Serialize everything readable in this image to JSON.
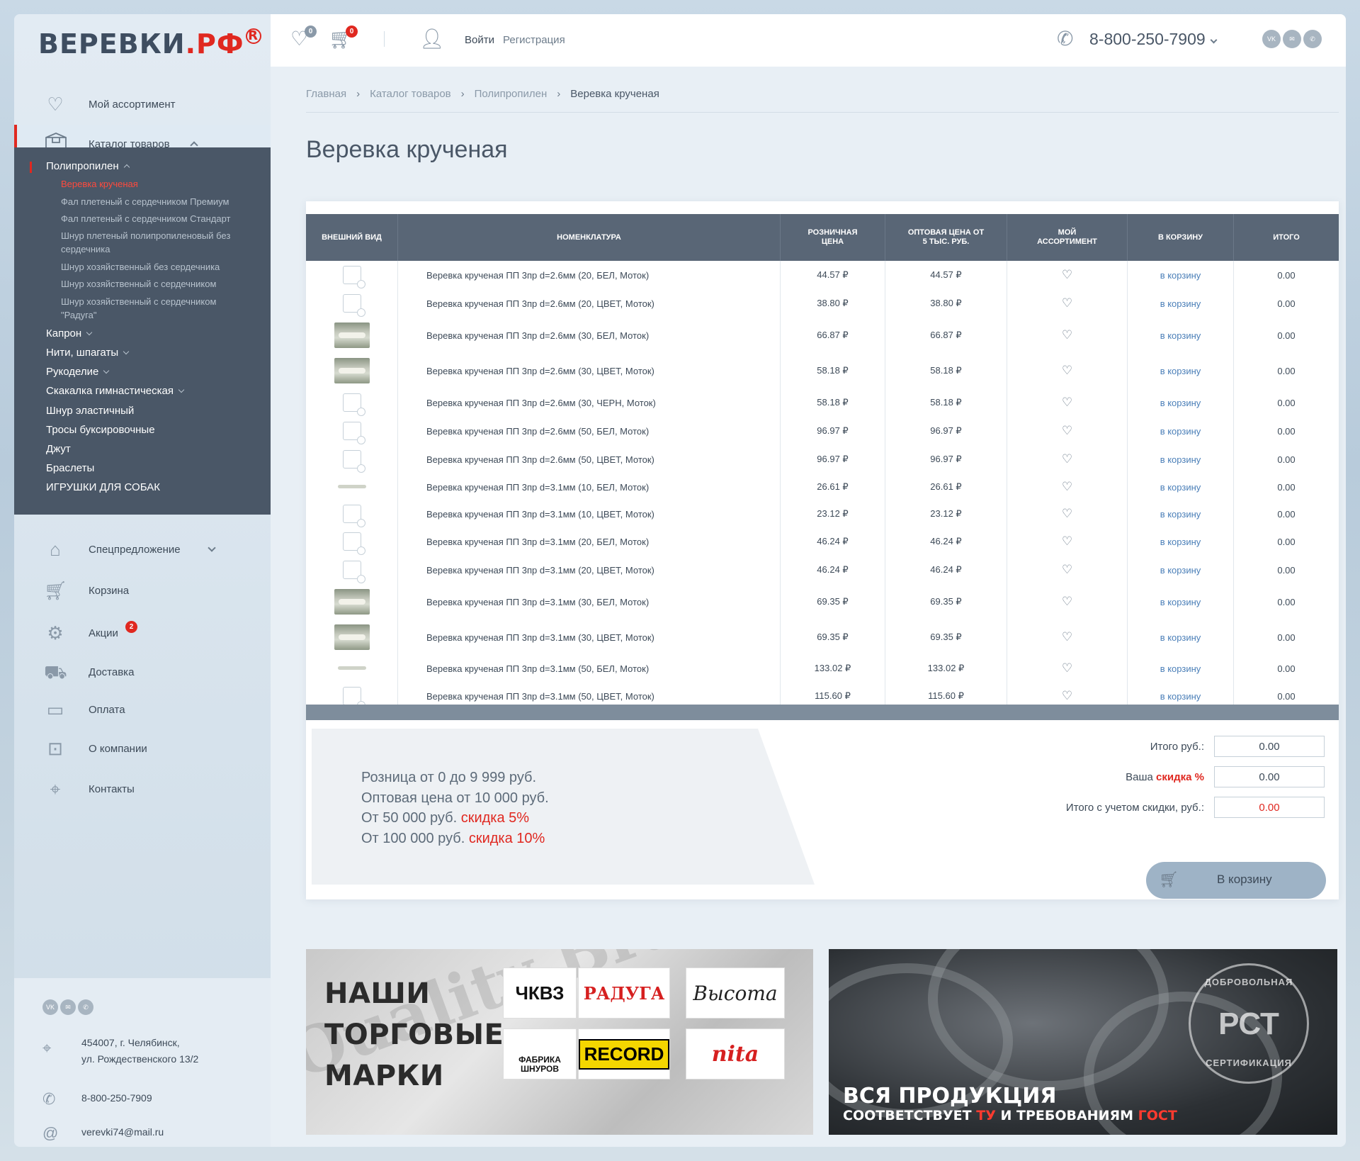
{
  "logo": {
    "text": "ВЕРЕВКИ",
    "suffix": ".РФ",
    "reg": "R"
  },
  "sidebar": {
    "items": [
      {
        "label": "Мой ассортимент",
        "icon": "heart-icon"
      },
      {
        "label": "Каталог товаров",
        "icon": "box-icon"
      },
      {
        "label": "Спецпредложение",
        "icon": "tag-icon"
      },
      {
        "label": "Корзина",
        "icon": "cart-icon"
      },
      {
        "label": "Акции",
        "icon": "percent-gear-icon",
        "badge": "2"
      },
      {
        "label": "Доставка",
        "icon": "truck-icon"
      },
      {
        "label": "Оплата",
        "icon": "card-icon"
      },
      {
        "label": "О компании",
        "icon": "briefcase-icon"
      },
      {
        "label": "Контакты",
        "icon": "location-icon"
      }
    ],
    "catalog": {
      "group": "Полипропилен",
      "subs": [
        "Веревка крученая",
        "Фал плетеный с сердечником Премиум",
        "Фал плетеный с сердечником Стандарт",
        "Шнур плетеный полипропиленовый без сердечника",
        "Шнур хозяйственный без сердечника",
        "Шнур хозяйственный с сердечником",
        "Шнур хозяйственный с сердечником \"Радуга\""
      ],
      "others": [
        "Капрон",
        "Нити, шпагаты",
        "Рукоделие",
        "Скакалка гимнастическая",
        "Шнур эластичный",
        "Тросы буксировочные",
        "Джут",
        "Браслеты",
        "ИГРУШКИ ДЛЯ СОБАК"
      ]
    },
    "contacts": {
      "social": [
        "VK",
        "✉",
        "✆"
      ],
      "address_1": "454007, г. Челябинск,",
      "address_2": "ул. Рождественского 13/2",
      "phone": "8-800-250-7909",
      "email": "verevki74@mail.ru"
    }
  },
  "header": {
    "favorites_count": "0",
    "cart_count": "0",
    "login": "Войти",
    "register": "Регистрация",
    "phone": "8-800-250-7909",
    "social": [
      "VK",
      "✉",
      "✆"
    ]
  },
  "breadcrumbs": [
    "Главная",
    "Каталог товаров",
    "Полипропилен",
    "Веревка крученая"
  ],
  "page_title": "Веревка крученая",
  "table": {
    "headers": [
      "ВНЕШНИЙ ВИД",
      "НОМЕНКЛАТУРА",
      "РОЗНИЧНАЯ ЦЕНА",
      "ОПТОВАЯ ЦЕНА ОТ 5 ТЫС. РУБ.",
      "МОЙ АССОРТИМЕНТ",
      "В КОРЗИНУ",
      "ИТОГО"
    ],
    "cart_label": "в корзину",
    "rows": [
      {
        "img": "none",
        "name": "Веревка крученая ПП 3пр d=2.6мм (20, БЕЛ, Моток)",
        "retail": "44.57 ₽",
        "wholesale": "44.57 ₽",
        "total": "0.00"
      },
      {
        "img": "none",
        "name": "Веревка крученая ПП 3пр d=2.6мм (20, ЦВЕТ, Моток)",
        "retail": "38.80 ₽",
        "wholesale": "38.80 ₽",
        "total": "0.00"
      },
      {
        "img": "photo",
        "name": "Веревка крученая ПП 3пр d=2.6мм (30, БЕЛ, Моток)",
        "retail": "66.87 ₽",
        "wholesale": "66.87 ₽",
        "total": "0.00"
      },
      {
        "img": "photo",
        "name": "Веревка крученая ПП 3пр d=2.6мм (30, ЦВЕТ, Моток)",
        "retail": "58.18 ₽",
        "wholesale": "58.18 ₽",
        "total": "0.00"
      },
      {
        "img": "none",
        "name": "Веревка крученая ПП 3пр d=2.6мм (30, ЧЕРН, Моток)",
        "retail": "58.18 ₽",
        "wholesale": "58.18 ₽",
        "total": "0.00"
      },
      {
        "img": "none",
        "name": "Веревка крученая ПП 3пр d=2.6мм (50, БЕЛ, Моток)",
        "retail": "96.97 ₽",
        "wholesale": "96.97 ₽",
        "total": "0.00"
      },
      {
        "img": "none",
        "name": "Веревка крученая ПП 3пр d=2.6мм (50, ЦВЕТ, Моток)",
        "retail": "96.97 ₽",
        "wholesale": "96.97 ₽",
        "total": "0.00"
      },
      {
        "img": "small",
        "name": "Веревка крученая ПП 3пр d=3.1мм (10, БЕЛ, Моток)",
        "retail": "26.61 ₽",
        "wholesale": "26.61 ₽",
        "total": "0.00"
      },
      {
        "img": "none",
        "name": "Веревка крученая ПП 3пр d=3.1мм (10, ЦВЕТ, Моток)",
        "retail": "23.12 ₽",
        "wholesale": "23.12 ₽",
        "total": "0.00"
      },
      {
        "img": "none",
        "name": "Веревка крученая ПП 3пр d=3.1мм (20, БЕЛ, Моток)",
        "retail": "46.24 ₽",
        "wholesale": "46.24 ₽",
        "total": "0.00"
      },
      {
        "img": "none",
        "name": "Веревка крученая ПП 3пр d=3.1мм (20, ЦВЕТ, Моток)",
        "retail": "46.24 ₽",
        "wholesale": "46.24 ₽",
        "total": "0.00"
      },
      {
        "img": "photo",
        "name": "Веревка крученая ПП 3пр d=3.1мм (30, БЕЛ, Моток)",
        "retail": "69.35 ₽",
        "wholesale": "69.35 ₽",
        "total": "0.00"
      },
      {
        "img": "photo",
        "name": "Веревка крученая ПП 3пр d=3.1мм (30, ЦВЕТ, Моток)",
        "retail": "69.35 ₽",
        "wholesale": "69.35 ₽",
        "total": "0.00"
      },
      {
        "img": "small",
        "name": "Веревка крученая ПП 3пр d=3.1мм (50, БЕЛ, Моток)",
        "retail": "133.02 ₽",
        "wholesale": "133.02 ₽",
        "total": "0.00"
      },
      {
        "img": "none",
        "name": "Веревка крученая ПП 3пр d=3.1мм (50, ЦВЕТ, Моток)",
        "retail": "115.60 ₽",
        "wholesale": "115.60 ₽",
        "total": "0.00"
      }
    ]
  },
  "promo": {
    "line1": "Розница от 0 до 9 999 руб.",
    "line2": "Оптовая цена от 10 000 руб.",
    "line3_pre": "От 50 000 руб.",
    "line3_red": "скидка 5%",
    "line4_pre": "От 100 000 руб.",
    "line4_red": "скидка 10%"
  },
  "summary": {
    "total_label": "Итого руб.:",
    "total_value": "0.00",
    "discount_label_pre": "Ваша",
    "discount_label_red": "скидка %",
    "discount_value": "0.00",
    "final_label": "Итого с учетом скидки, руб.:",
    "final_value": "0.00",
    "cart_button": "В корзину"
  },
  "banner_brands": {
    "title_1": "НАШИ",
    "title_2": "ТОРГОВЫЕ",
    "title_3": "МАРКИ",
    "brands": [
      "ЧКВЗ",
      "РАДУГА",
      "Высота",
      "ФАБРИКА ШНУРОВ",
      "RECORD",
      "nita"
    ]
  },
  "banner_gost": {
    "seal_top": "ДОБРОВОЛЬНАЯ",
    "seal_mid": "РСТ",
    "seal_bottom": "СЕРТИФИКАЦИЯ",
    "title": "ВСЯ ПРОДУКЦИЯ",
    "sub_1": "СООТВЕТСТВУЕТ",
    "sub_red_1": "ТУ",
    "sub_2": "И ТРЕБОВАНИЯМ",
    "sub_red_2": "ГОСТ"
  },
  "colors": {
    "accent": "#e02820",
    "sidebar_dark": "#4a5767",
    "table_header": "#596676",
    "link": "#4b7fb8"
  }
}
